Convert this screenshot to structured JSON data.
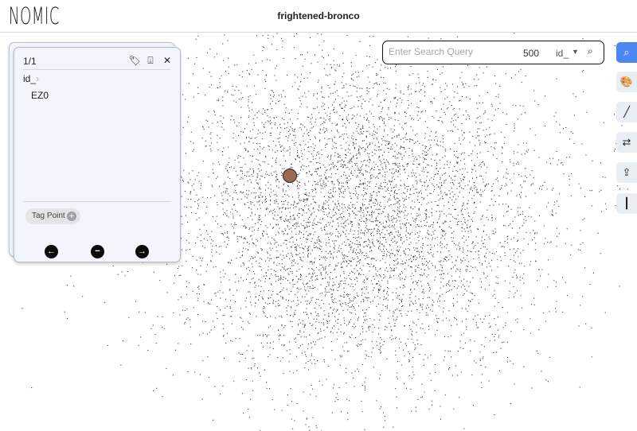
{
  "header": {
    "logo": "NOMIC",
    "project_title": "frightened-bronco"
  },
  "point_card": {
    "count": "1/1",
    "field_label": "id_",
    "field_value": "EZ0",
    "tag_button_label": "Tag Point",
    "tag_plus": "+"
  },
  "search": {
    "placeholder": "Enter Search Query",
    "result_count": "500",
    "field": "id_"
  },
  "toolbar": [
    {
      "name": "search-tool-button",
      "icon": "search-icon",
      "glyph": "⌕",
      "active": true
    },
    {
      "name": "color-tool-button",
      "icon": "palette-icon",
      "glyph": "🎨",
      "active": false
    },
    {
      "name": "lasso-tool-button",
      "icon": "pencil-icon",
      "glyph": "╱",
      "active": false
    },
    {
      "name": "swap-tool-button",
      "icon": "swap-icon",
      "glyph": "⇄",
      "active": false
    },
    {
      "name": "share-tool-button",
      "icon": "share-icon",
      "glyph": "⇪",
      "active": false
    },
    {
      "name": "pin-tool-button",
      "icon": "pin-icon",
      "glyph": "┃",
      "active": false
    }
  ],
  "map": {
    "point_color": "#3a3a3a",
    "selected_point_color": "#9a6a53",
    "accent": "#4c86f0"
  }
}
